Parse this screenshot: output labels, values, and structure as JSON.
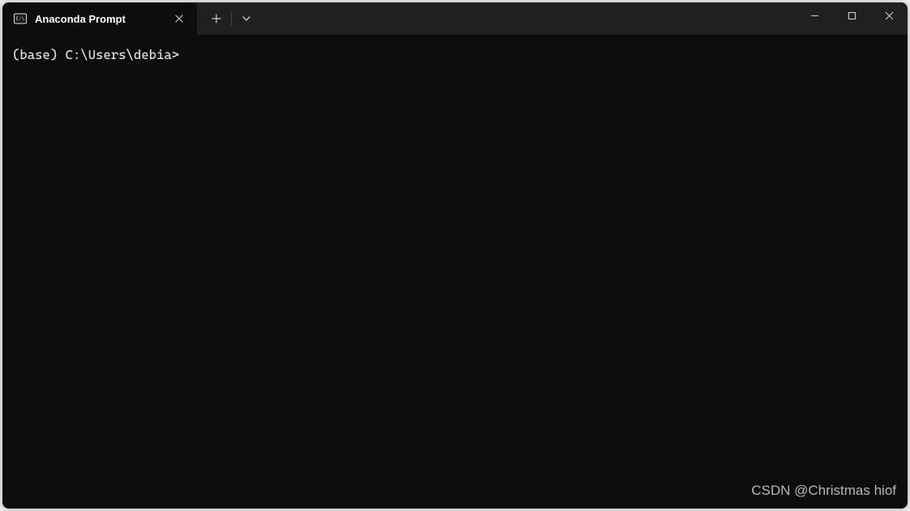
{
  "tab": {
    "title": "Anaconda Prompt",
    "icon": "cmd-icon"
  },
  "terminal": {
    "prompt": "(base) C:\\Users\\debia>"
  },
  "watermark": {
    "text": "CSDN @Christmas hiof"
  }
}
